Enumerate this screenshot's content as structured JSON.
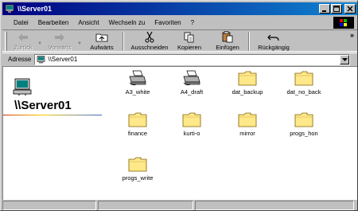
{
  "window": {
    "title": "\\\\Server01"
  },
  "menu": [
    "Datei",
    "Bearbeiten",
    "Ansicht",
    "Wechseln zu",
    "Favoriten",
    "?"
  ],
  "toolbar": {
    "back": "Zurück",
    "forward": "Vorwärts",
    "up": "Aufwärts",
    "cut": "Ausschneiden",
    "copy": "Kopieren",
    "paste": "Einfügen",
    "undo": "Rückgängig",
    "more": "»"
  },
  "address": {
    "label": "Adresse",
    "value": "\\\\Server01"
  },
  "sidebar": {
    "title": "\\\\Server01"
  },
  "items": [
    {
      "label": "A3_white",
      "icon": "printer-icon"
    },
    {
      "label": "A4_draft",
      "icon": "printer-icon"
    },
    {
      "label": "dat_backup",
      "icon": "folder-icon"
    },
    {
      "label": "dat_no_back",
      "icon": "folder-icon"
    },
    {
      "label": "finance",
      "icon": "folder-icon"
    },
    {
      "label": "kurti-o",
      "icon": "folder-icon"
    },
    {
      "label": "mirror",
      "icon": "folder-icon"
    },
    {
      "label": "progs_hon",
      "icon": "folder-icon"
    },
    {
      "label": "progs_write",
      "icon": "folder-icon"
    }
  ],
  "colors": {
    "titlebar_start": "#000080",
    "titlebar_end": "#1084d0",
    "folder": "#ffe88a"
  }
}
